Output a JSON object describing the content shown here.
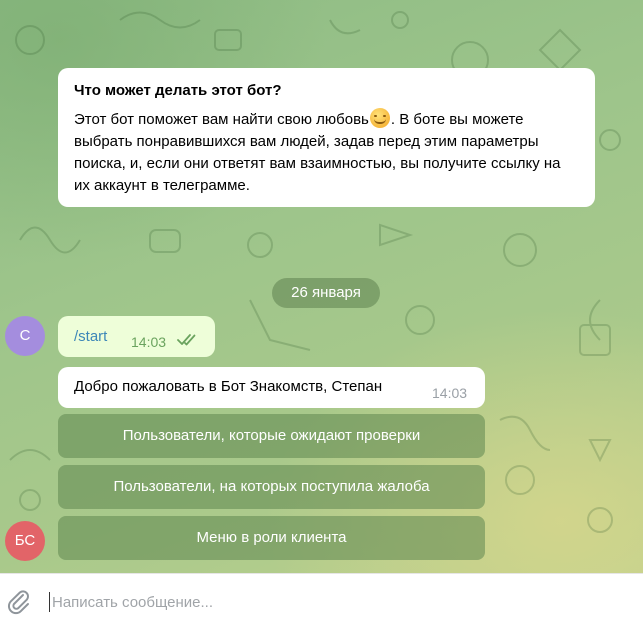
{
  "bot_info": {
    "title": "Что может делать этот бот?",
    "text_before_emoji": "Этот бот поможет вам найти свою любовь",
    "emoji": "relieved-face-emoji",
    "text_after_emoji": ". В боте вы можете выбрать понравившихся вам людей, задав перед этим параметры поиска, и, если они ответят вам взаимностью, вы получите ссылку на их аккаунт в телеграмме."
  },
  "date_separator": "26 января",
  "messages": [
    {
      "avatar": "С",
      "text": "/start",
      "time": "14:03",
      "status_icon": "double-check-icon"
    },
    {
      "text": "Добро пожаловать в Бот Знакомств, Степан",
      "time": "14:03"
    }
  ],
  "keyboard": [
    {
      "label": "Пользователи, которые ожидают проверки"
    },
    {
      "label": "Пользователи, на которых поступила жалоба"
    },
    {
      "label": "Меню в роли клиента"
    }
  ],
  "bot_avatar": "БС",
  "composer": {
    "placeholder": "Написать сообщение...",
    "attach_icon": "paperclip-icon"
  },
  "colors": {
    "outgoing_bubble": "#eefed9",
    "link": "#3d87b8",
    "user_avatar": "#a48dde",
    "bot_avatar": "#e26468"
  }
}
